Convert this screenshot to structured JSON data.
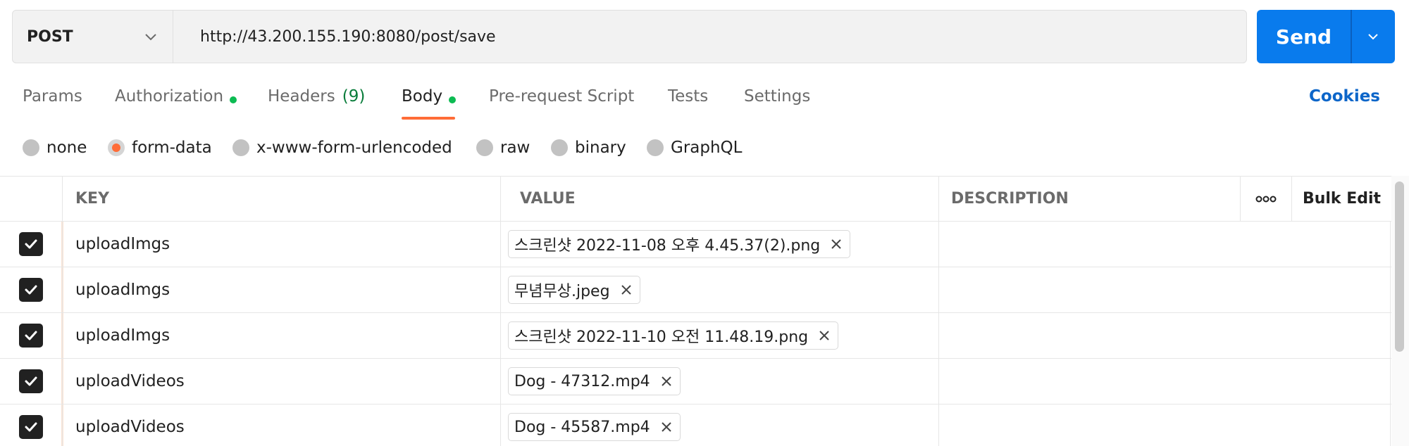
{
  "request": {
    "method": "POST",
    "url": "http://43.200.155.190:8080/post/save",
    "send_label": "Send"
  },
  "tabs": [
    {
      "label": "Params"
    },
    {
      "label": "Authorization",
      "dot": true
    },
    {
      "label": "Headers",
      "count": "(9)"
    },
    {
      "label": "Body",
      "dot": true,
      "active": true
    },
    {
      "label": "Pre-request Script"
    },
    {
      "label": "Tests"
    },
    {
      "label": "Settings"
    }
  ],
  "cookies_label": "Cookies",
  "body_types": [
    {
      "label": "none"
    },
    {
      "label": "form-data",
      "selected": true
    },
    {
      "label": "x-www-form-urlencoded"
    },
    {
      "label": "raw"
    },
    {
      "label": "binary"
    },
    {
      "label": "GraphQL"
    }
  ],
  "table": {
    "headers": {
      "key": "KEY",
      "value": "VALUE",
      "description": "DESCRIPTION",
      "bulk_edit": "Bulk Edit"
    },
    "rows": [
      {
        "checked": true,
        "key": "uploadImgs",
        "file": "스크린샷 2022-11-08 오후 4.45.37(2).png",
        "description": ""
      },
      {
        "checked": true,
        "key": "uploadImgs",
        "file": "무념무상.jpeg",
        "description": ""
      },
      {
        "checked": true,
        "key": "uploadImgs",
        "file": "스크린샷 2022-11-10 오전 11.48.19.png",
        "description": ""
      },
      {
        "checked": true,
        "key": "uploadVideos",
        "file": "Dog - 47312.mp4",
        "description": ""
      },
      {
        "checked": true,
        "key": "uploadVideos",
        "file": "Dog - 45587.mp4",
        "description": ""
      }
    ]
  },
  "colors": {
    "accent": "#ff6c37",
    "send_blue": "#097bed",
    "dot_green": "#0cbb52",
    "link_blue": "#0d66c9"
  },
  "icons": {
    "method_dropdown": "chevron-down-icon",
    "send_dropdown": "chevron-down-icon",
    "checkbox": "checkmark-icon",
    "remove_file": "close-icon",
    "more": "more-horizontal-icon"
  }
}
